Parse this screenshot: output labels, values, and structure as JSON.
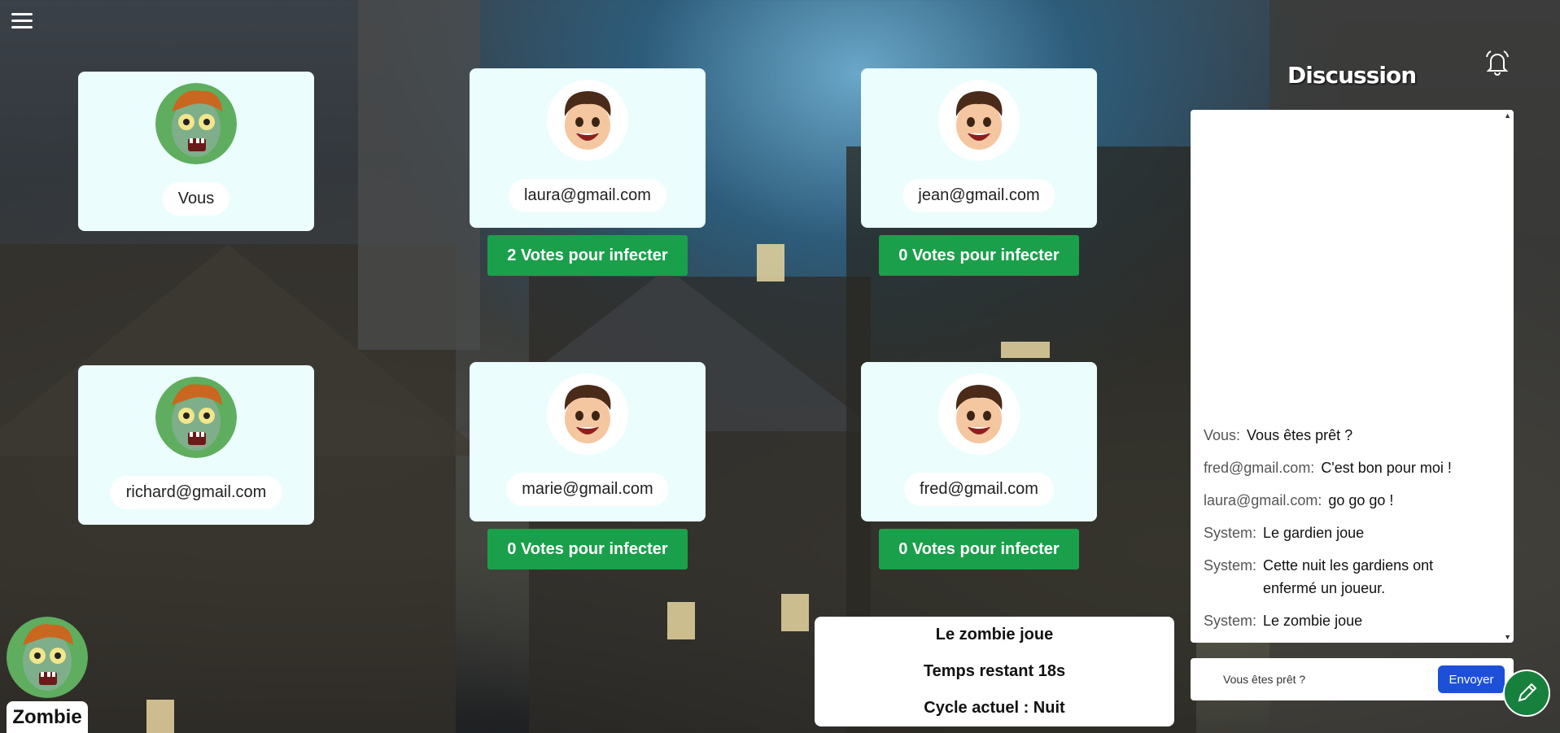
{
  "players": [
    {
      "name": "Vous",
      "avatar": "zombie-avatar",
      "votes_label": ""
    },
    {
      "name": "laura@gmail.com",
      "avatar": "boy-avatar",
      "votes_label": "2 Votes pour infecter"
    },
    {
      "name": "jean@gmail.com",
      "avatar": "boy-avatar",
      "votes_label": "0 Votes pour infecter"
    },
    {
      "name": "richard@gmail.com",
      "avatar": "zombie-avatar",
      "votes_label": ""
    },
    {
      "name": "marie@gmail.com",
      "avatar": "boy-avatar",
      "votes_label": "0 Votes pour infecter"
    },
    {
      "name": "fred@gmail.com",
      "avatar": "boy-avatar",
      "votes_label": "0 Votes pour infecter"
    }
  ],
  "chat": {
    "title": "Discussion",
    "messages": [
      {
        "sender": "Vous:",
        "text": "Vous êtes prêt ?"
      },
      {
        "sender": "fred@gmail.com:",
        "text": "C'est bon pour moi !"
      },
      {
        "sender": "laura@gmail.com:",
        "text": "go go go !"
      },
      {
        "sender": "System:",
        "text": "Le gardien joue"
      },
      {
        "sender": "System:",
        "text": "Cette nuit les gardiens ont enfermé un joueur."
      },
      {
        "sender": "System:",
        "text": "Le zombie joue"
      }
    ],
    "input_value": "Vous êtes prêt ?",
    "send_label": "Envoyer"
  },
  "status": {
    "turn": "Le zombie joue",
    "time_left": "Temps restant 18s",
    "cycle": "Cycle actuel : Nuit"
  },
  "my_role": {
    "label": "Zombie",
    "avatar": "zombie-avatar"
  },
  "colors": {
    "card_bg": "#ebfdfd",
    "vote_button": "#1aa04a",
    "send_button": "#1d4fd8",
    "fab": "#16803c"
  }
}
